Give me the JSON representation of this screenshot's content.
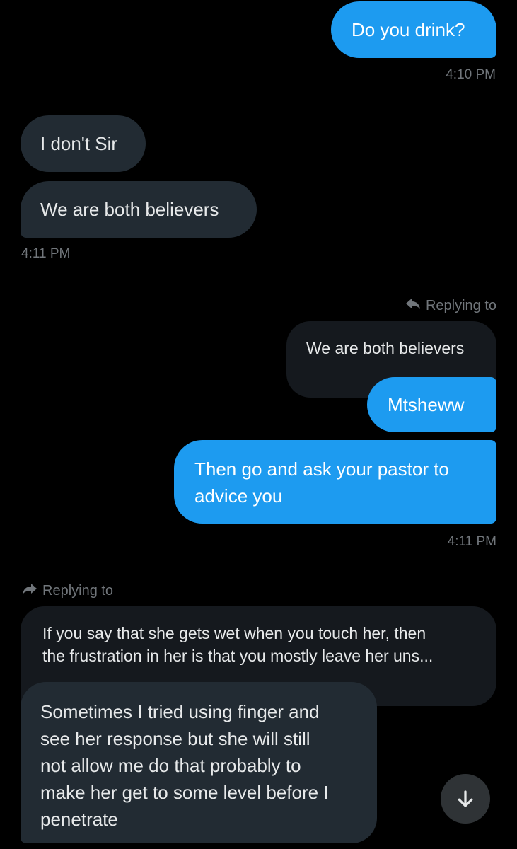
{
  "messages": {
    "m1": "Do you drink?",
    "t1": "4:10 PM",
    "m2": "I don't Sir",
    "m3": "We are both believers",
    "t2": "4:11 PM",
    "reply1_label": "Replying to",
    "quote1": "We are both believers",
    "m4": "Mtsheww",
    "m5_line1": "Then go and ask your pastor to",
    "m5_line2": "advice you",
    "t3": "4:11 PM",
    "reply2_label": "Replying to",
    "quote2_line1": "If you say that she gets wet when you touch her, then",
    "quote2_line2": "the frustration in her is that you mostly leave her uns...",
    "m6_line1": "Sometimes I tried using finger and",
    "m6_line2": "see her response but she will still",
    "m6_line3": "not allow me do that probably to",
    "m6_line4": "make her get to some level before I",
    "m6_line5": "penetrate"
  },
  "colors": {
    "outgoing": "#1d9bf0",
    "incoming": "#222b33",
    "quote": "#15191e",
    "timestamp": "#71767b",
    "background": "#000000"
  },
  "icons": {
    "reply_out": "reply-arrow-icon",
    "reply_in": "forward-arrow-icon",
    "scroll_down": "arrow-down-icon"
  }
}
